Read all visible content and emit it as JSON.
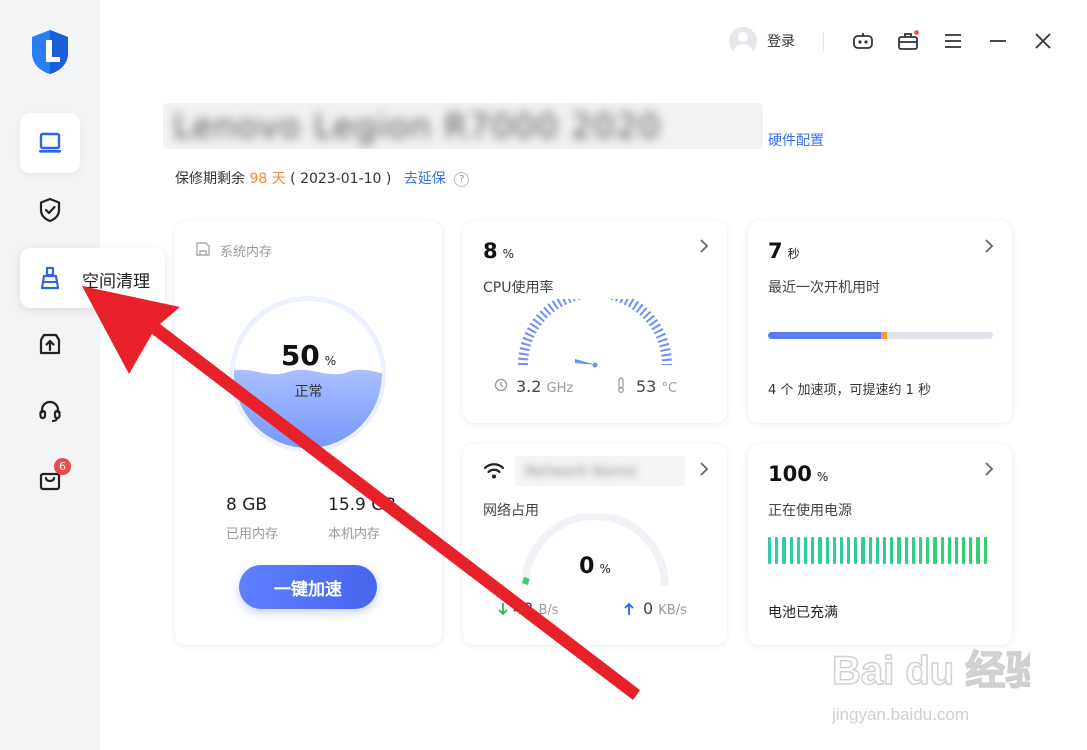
{
  "sidebar": {
    "tooltip_label": "空间清理",
    "badge_count": "6",
    "items": [
      {
        "name": "device-icon"
      },
      {
        "name": "shield-check-icon"
      },
      {
        "name": "broom-icon"
      },
      {
        "name": "upgrade-box-icon"
      },
      {
        "name": "headset-icon"
      },
      {
        "name": "shopping-bag-icon"
      }
    ]
  },
  "topbar": {
    "login_label": "登录"
  },
  "device": {
    "model_blurred": "Lenovo Legion R7000 2020",
    "hardware_link": "硬件配置",
    "warranty_prefix": "保修期剩余",
    "warranty_days": "98 天",
    "warranty_date": "( 2023-01-10 )",
    "extend_link": "去延保"
  },
  "memory": {
    "title": "系统内存",
    "percent": "50",
    "percent_unit": "%",
    "status": "正常",
    "used_value": "8 GB",
    "used_label": "已用内存",
    "total_value": "15.9 GB",
    "total_label": "本机内存",
    "speed_button": "一键加速",
    "usage_fraction": 0.5
  },
  "cpu": {
    "value": "8",
    "unit": "%",
    "label": "CPU使用率",
    "freq_value": "3.2",
    "freq_unit": "GHz",
    "temp_value": "53",
    "temp_unit": "°C",
    "usage_fraction": 0.08
  },
  "boot": {
    "value": "7",
    "unit": "秒",
    "label": "最近一次开机用时",
    "note": "4 个 加速项，可提速约 1 秒",
    "progress_fraction": 0.5
  },
  "network": {
    "ssid_blurred": "Network Name",
    "label": "网络占用",
    "value": "0",
    "unit": "%",
    "down_value": "43",
    "down_unit": "B/s",
    "up_value": "0",
    "up_unit": "KB/s"
  },
  "power": {
    "value": "100",
    "unit": "%",
    "label": "正在使用电源",
    "status": "电池已充满",
    "charge_fraction": 1.0
  },
  "watermark": {
    "brand": "Bai du 经验",
    "url": "jingyan.baidu.com"
  },
  "colors": {
    "accent_blue": "#4866ee",
    "warning_orange": "#f58a3c",
    "battery_green": "#2fd26c",
    "badge_red": "#f04848",
    "arrow_red": "#e8202a"
  }
}
